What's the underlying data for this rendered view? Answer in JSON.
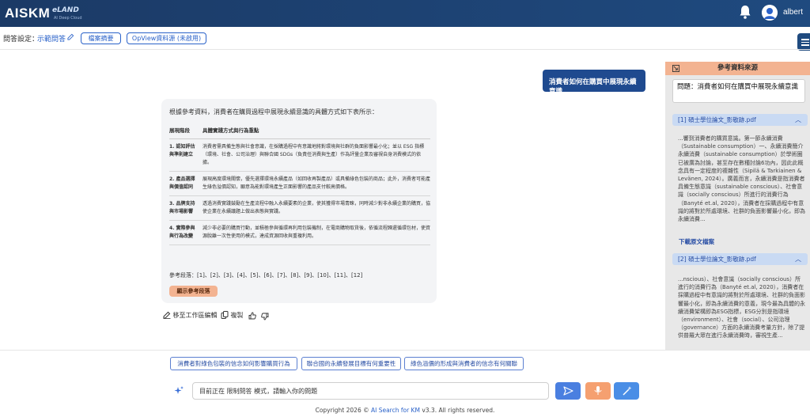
{
  "header": {
    "logo": "AISKM",
    "brand": "eLAND",
    "brand_sub": "AI Deep Cloud",
    "username": "albert"
  },
  "toolbar": {
    "settings_label": "問答設定：",
    "settings_value": "示範問答",
    "doc_summary_button": "檔案摘要",
    "opview_button": "OpView資料源 (未啟用)"
  },
  "chat": {
    "user_message": "消費者如何在購買中展現永續意識",
    "answer": {
      "intro": "根據參考資料，消費者在購買過程中展現永續意識的具體方式如下表所示：",
      "table_headers": [
        "展現階段",
        "具體實踐方式與行為重點"
      ],
      "rows": [
        {
          "stage": "1. 認知評估與準則建立",
          "detail": "消費者需具備生態與社會意識，在採購過程中有意識地將對環境與社群的負面影響最小化；並以 ESG 指標（環境、社會、公司治理）與聯合國 SDGs（負責任消費與生產）作為評量企業及審視自身消費模式的依據。"
        },
        {
          "stage": "2. 產品選擇與價值認同",
          "detail": "展現高度環境關懷，優先選擇環境永續產品（如回收再製產品）或具備綠色包裝的商品；此外，消費者可能產生綠色溢價認知，願意為能對環境產生正面影響的產品支付較高價格。"
        },
        {
          "stage": "3. 品牌支持與市場影響",
          "detail": "透過消費實踐鼓勵在生產流程中融入永續要素的企業，使其獲得市場青睞，同時減少對非永續企業的購買，協使企業在永續議題上做出表態與實踐。"
        },
        {
          "stage": "4. 實際參與與行為改變",
          "detail": "減少非必要的購買行動，並積極參與循環再利用包裝機制，在電商購物取貨後，依循流程歸還循環包材，使資源脫離一次性使用的模式，達成資源回收與重複利用。"
        }
      ],
      "refs_label": "參考段落：[1]、[2]、[3]、[4]、[5]、[6]、[7]、[8]、[9]、[10]、[11]、[12]",
      "show_refs_button": "顯示參考段落"
    },
    "actions": {
      "move_to_editor": "移至工作區編輯",
      "copy": "複製"
    },
    "suggestions": [
      "消費者對綠色包裝的信念如何影響購買行為",
      "聯合國的永續發展目標有何重要性",
      "綠色溢價的形成與消費者的信念有何關聯"
    ],
    "input_placeholder": "目前正在 限制問答 模式，請輸入你的問題"
  },
  "footer": {
    "prefix": "Copyright 2026 © ",
    "link": "AI Search for KM",
    "suffix": " v3.3. All rights reserved."
  },
  "panel": {
    "title": "參考資料來源",
    "question": "問題：消費者如何在購買中展現永續意識",
    "docs": [
      {
        "title": "[1] 碩士學位論文_影敬跡.pdf",
        "body": "...響到消費者的購買意識。第一節永續消費（Sustainable consumption）一、永續消費簡介永續消費（sustainable consumption）於學術圈已被廣為討論，甚至存在數種討論6功內，因此此概念具有一定程度的複雜性（Sipilä & Tarkiainen & Levänen, 2024）。廣義而言，永續消費是指消費者具備生態意識（sustainable conscious）、社會意識（socially conscious）所進行的消費行為（Banyté et.al, 2020），消費者在採購過程中有意識的將對於所處環境、社群的負面影響最小化，即為永續消費...",
        "link": "下載原文檔案"
      },
      {
        "title": "[2] 碩士學位論文_影敬跡.pdf",
        "body": "...nscious）、社會意識（socially conscious）所進行的消費行為（Banyté et.al, 2020），消費者在採購過程中有意識的將對於所處環境、社群的負面影響最小化，即為永續消費的意義，現今最為具體的永續消費架構即為ESG指標，ESG分別是指環境（environment）、社會（social）、公司治理（governance）方面的永續消費考量方針，除了提供普羅大眾在進行永續消費時，審視生產..."
      }
    ]
  },
  "colors": {
    "header_bg": "#1f4a7f",
    "accent_blue": "#2a62c9",
    "user_bubble": "#1f4a8f",
    "peach": "#f3b391",
    "send_button": "#4a7fe0",
    "mic_button": "#f5a070",
    "clear_button": "#4a8ee6"
  }
}
